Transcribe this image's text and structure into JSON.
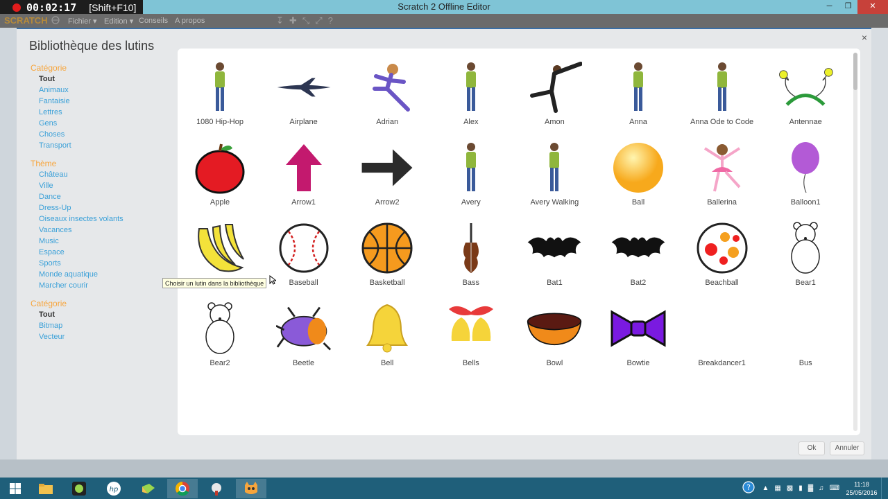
{
  "recorder": {
    "timer": "00:02:17",
    "shortcut": "[Shift+F10]"
  },
  "window": {
    "title": "Scratch 2 Offline Editor"
  },
  "menubar": {
    "items": [
      "Fichier ▾",
      "Edition ▾",
      "Conseils",
      "A propos"
    ],
    "logo": "SCRATCH"
  },
  "dialog": {
    "title": "Bibliothèque des lutins",
    "close": "×",
    "category_header": "Catégorie",
    "categories": [
      "Tout",
      "Animaux",
      "Fantaisie",
      "Lettres",
      "Gens",
      "Choses",
      "Transport"
    ],
    "theme_header": "Thème",
    "themes": [
      "Château",
      "Ville",
      "Dance",
      "Dress-Up",
      "Oiseaux insectes volants",
      "Vacances",
      "Music",
      "Espace",
      "Sports",
      "Monde aquatique",
      "Marcher courir"
    ],
    "type_header": "Catégorie",
    "types": [
      "Tout",
      "Bitmap",
      "Vecteur"
    ],
    "ok_label": "Ok",
    "cancel_label": "Annuler",
    "tooltip": "Choisir un lutin dans la bibliothèque"
  },
  "sprites": [
    "1080 Hip-Hop",
    "Airplane",
    "Adrian",
    "Alex",
    "Amon",
    "Anna",
    "Anna Ode to Code",
    "Antennae",
    "Apple",
    "Arrow1",
    "Arrow2",
    "Avery",
    "Avery Walking",
    "Ball",
    "Ballerina",
    "Balloon1",
    "Bananas",
    "Baseball",
    "Basketball",
    "Bass",
    "Bat1",
    "Bat2",
    "Beachball",
    "Bear1",
    "Bear2",
    "Beetle",
    "Bell",
    "Bells",
    "Bowl",
    "Bowtie",
    "Breakdancer1",
    "Bus"
  ],
  "sprite_icons": [
    "person-icon",
    "airplane-icon",
    "runner-icon",
    "person-icon",
    "dancer-icon",
    "person-icon",
    "person-icon",
    "antennae-icon",
    "apple-icon",
    "arrow-up-icon",
    "arrow-right-icon",
    "person-icon",
    "person-icon",
    "ball-icon",
    "ballerina-icon",
    "balloon-icon",
    "bananas-icon",
    "baseball-icon",
    "basketball-icon",
    "bass-icon",
    "bat-icon",
    "bat-icon",
    "beachball-icon",
    "bear-icon",
    "bear-icon",
    "beetle-icon",
    "bell-icon",
    "bells-icon",
    "bowl-icon",
    "bowtie-icon",
    "blank-icon",
    "blank-icon"
  ],
  "taskbar": {
    "time": "11:18",
    "date": "25/05/2016"
  },
  "colors": {
    "accent_orange": "#f7a53c",
    "link_blue": "#3aa0d8",
    "titlebar": "#7fc4d6",
    "taskbar": "#1f5f7a"
  }
}
